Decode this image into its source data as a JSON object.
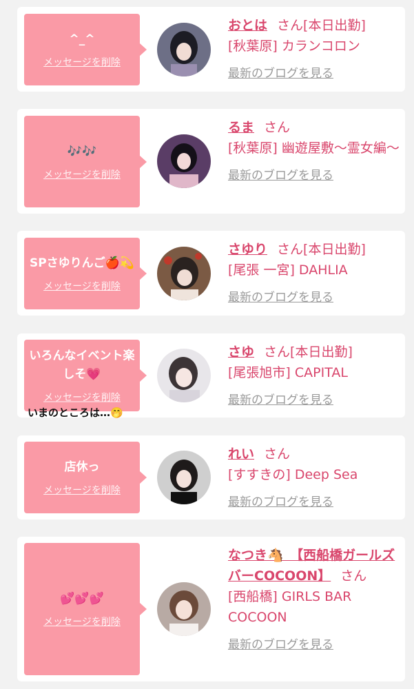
{
  "common": {
    "delete_label": "メッセージを削除",
    "blog_label": "最新のブログを見る",
    "san": "さん"
  },
  "cards": [
    {
      "message": "^_^",
      "name": "おとは",
      "status": "[本日出勤]",
      "shop": "[秋葉原] カランコロン"
    },
    {
      "message": "🎶🎶",
      "name": "るま",
      "status": "",
      "shop": "[秋葉原] 幽遊屋敷〜霊女編〜"
    },
    {
      "message": "SPさゆりんご🍎💫",
      "name": "さゆり",
      "status": "[本日出勤]",
      "shop": "[尾張 一宮] DAHLIA"
    },
    {
      "message": "いろんなイベント楽しそ💗",
      "name": "さゆ",
      "status": "[本日出勤]",
      "shop": "[尾張旭市] CAPITAL"
    },
    {
      "message": "店休っ",
      "name": "れい",
      "status": "",
      "shop": "[すすきの] Deep Sea"
    },
    {
      "message": "💕💕💕",
      "name": "なつき🐴　【西船橋ガールズバーCOCOON】",
      "status": "",
      "shop": "[西船橋] GIRLS BAR COCOON"
    }
  ],
  "overlay_note": "いまのところは…🤭",
  "colors": {
    "bubble": "#fa9aa6",
    "accent": "#d9466c",
    "link_gray": "#9a9a9a",
    "background": "#f2f2f2"
  }
}
